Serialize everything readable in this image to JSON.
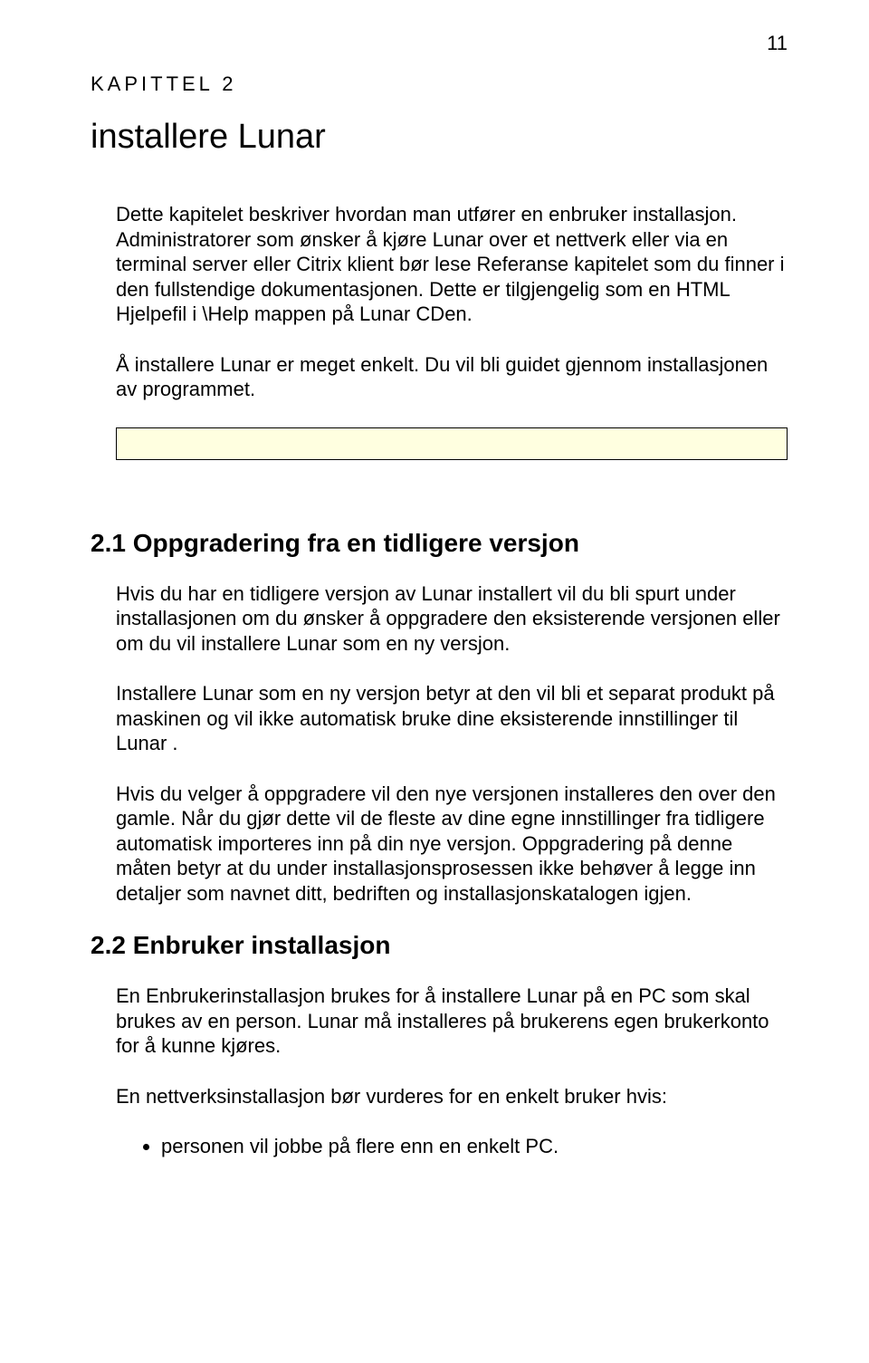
{
  "page_number": "11",
  "chapter_label": "KAPITTEL 2",
  "chapter_title": "installere Lunar",
  "intro_p1": "Dette kapitelet beskriver hvordan man utfører en enbruker installasjon. Administratorer som ønsker å kjøre Lunar over et nettverk eller via en terminal server eller Citrix klient bør lese Referanse kapitelet som du finner i den fullstendige dokumentasjonen. Dette er tilgjengelig som en HTML Hjelpefil i \\Help mappen på Lunar CDen.",
  "intro_p2": "Å installere Lunar er meget enkelt.  Du vil bli guidet gjennom installasjonen av programmet.",
  "section_2_1": {
    "heading": "2.1  Oppgradering fra en tidligere versjon",
    "p1": "Hvis du har en tidligere versjon av Lunar installert vil du bli spurt under installasjonen om du ønsker å oppgradere den eksisterende versjonen eller om du vil installere Lunar som en ny versjon.",
    "p2": "Installere Lunar som en ny versjon betyr at den vil bli et separat produkt på maskinen og vil ikke automatisk bruke dine eksisterende innstillinger til Lunar .",
    "p3": "Hvis du velger å oppgradere vil den nye versjonen installeres den over den gamle.  Når du gjør dette vil de fleste av dine egne innstillinger fra tidligere automatisk importeres inn på din nye versjon.  Oppgradering på denne måten betyr at du under installasjonsprosessen ikke behøver å legge inn detaljer som navnet ditt, bedriften og installasjonskatalogen igjen."
  },
  "section_2_2": {
    "heading": "2.2  Enbruker installasjon",
    "p1": "En Enbrukerinstallasjon brukes for å installere Lunar på en PC som skal brukes av en person. Lunar må installeres på brukerens egen brukerkonto for å kunne kjøres.",
    "p2": "En nettverksinstallasjon bør vurderes for en enkelt bruker hvis:",
    "bullet1": "personen vil jobbe på flere enn en enkelt PC."
  }
}
